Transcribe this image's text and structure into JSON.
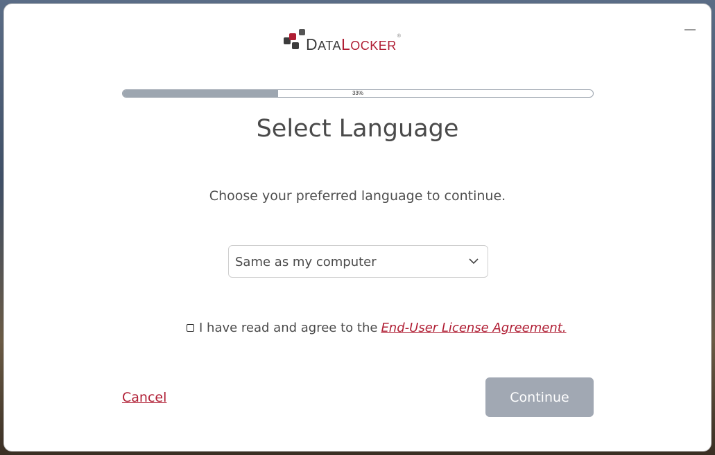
{
  "window": {
    "minimize_icon": "minimize-icon"
  },
  "logo": {
    "brand_part1": "Data",
    "brand_part2": "Locker",
    "registered": "®",
    "colors": {
      "dark": "#3c3c3c",
      "accent": "#b01e34"
    }
  },
  "progress": {
    "label": "33%",
    "value": 0.33,
    "fill_color": "#9da6b0"
  },
  "page_title": "Select Language",
  "instruction": "Choose your preferred language to continue.",
  "language_select": {
    "selected": "Same as my computer",
    "icon": "chevron-down-icon"
  },
  "agreement": {
    "checked": false,
    "text": "I have read and agree to the",
    "link_label": "End-User License Agreement."
  },
  "actions": {
    "cancel_label": "Cancel",
    "continue_label": "Continue",
    "continue_enabled": false
  },
  "colors": {
    "accent": "#b01e34",
    "button_disabled": "#a1a8b3",
    "text": "#4a4a4a"
  }
}
